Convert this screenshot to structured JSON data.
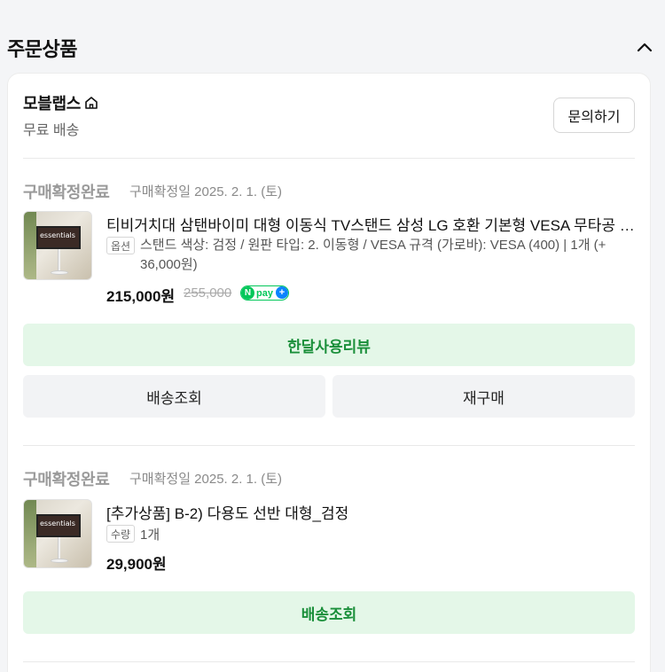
{
  "section": {
    "title": "주문상품"
  },
  "seller": {
    "name": "모블랩스",
    "shipping": "무료 배송",
    "inquiry_label": "문의하기"
  },
  "orders": [
    {
      "status": "구매확정완료",
      "date": "구매확정일 2025. 2. 1. (토)",
      "product_name": "티비거치대 삼탠바이미 대형 이동식 TV스탠드 삼성 LG 호환 기본형 VESA 무타공 전동 회",
      "option_tag": "옵션",
      "option_line1": "스탠드 색상: 검정 / 원판 타입: 2. 이동형 / VESA 규격 (가로바): VESA (400)  |  1개 (+",
      "option_line2": "36,000원)",
      "price": "215,000원",
      "original_price": "255,000",
      "npay_label": "pay",
      "thumb_text": "essentials",
      "buttons": {
        "review": "한달사용리뷰",
        "tracking": "배송조회",
        "rebuy": "재구매"
      }
    },
    {
      "status": "구매확정완료",
      "date": "구매확정일 2025. 2. 1. (토)",
      "product_name": "[추가상품] B-2) 다용도 선반 대형_검정",
      "qty_tag": "수량",
      "qty": "1개",
      "price": "29,900원",
      "thumb_text": "essentials",
      "buttons": {
        "tracking": "배송조회"
      }
    }
  ],
  "colors": {
    "green_button_bg": "#e4f7e8",
    "green_button_text": "#1a8f3a",
    "npay_green": "#03c75a"
  },
  "icons": [
    "chevron-up-icon",
    "home-icon"
  ]
}
